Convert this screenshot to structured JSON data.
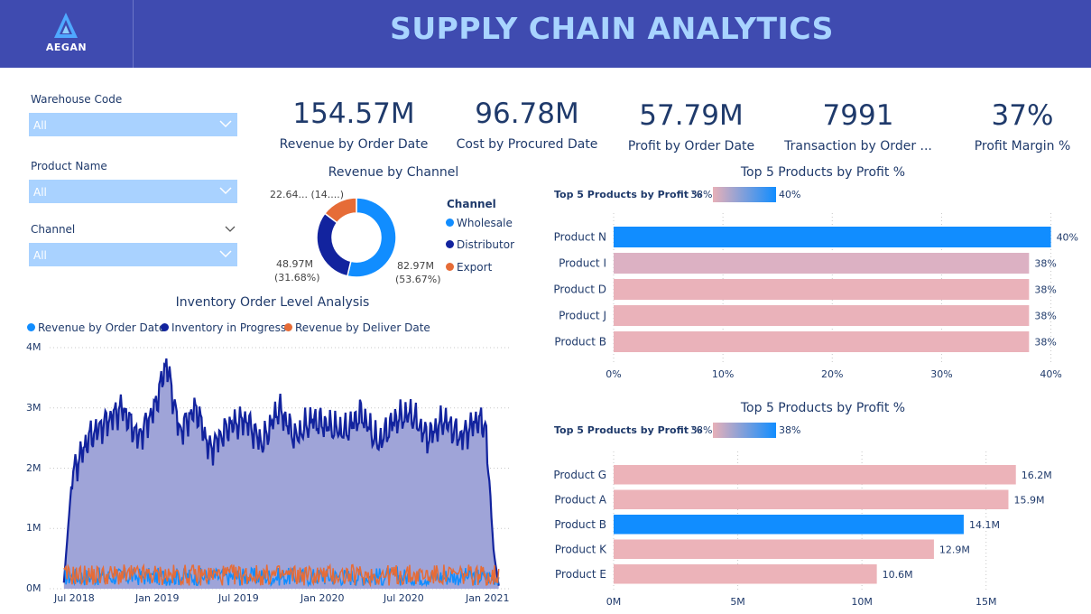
{
  "header": {
    "logo_text": "AEGAN",
    "title": "SUPPLY CHAIN ANALYTICS"
  },
  "filters": [
    {
      "label": "Warehouse Code",
      "value": "All"
    },
    {
      "label": "Product Name",
      "value": "All"
    },
    {
      "label": "Channel",
      "value": "All"
    }
  ],
  "kpis": [
    {
      "value": "154.57M",
      "label": "Revenue by Order Date"
    },
    {
      "value": "96.78M",
      "label": "Cost by Procured Date"
    },
    {
      "value": "57.79M",
      "label": "Profit by Order Date"
    },
    {
      "value": "7991",
      "label": "Transaction by Order ..."
    },
    {
      "value": "37%",
      "label": "Profit Margin %"
    }
  ],
  "colors": {
    "header": "#3f4bb0",
    "accent": "#118dff",
    "navy": "#12239e",
    "orange": "#e66c37",
    "pink": "#e8b0b8",
    "slicer": "#a9d2ff"
  },
  "chart_data": [
    {
      "type": "pie",
      "title": "Revenue by Channel",
      "legend_title": "Channel",
      "legend_position": "right",
      "categories": [
        "Wholesale",
        "Distributor",
        "Export"
      ],
      "values": [
        82.97,
        48.97,
        22.64
      ],
      "percents": [
        53.67,
        31.68,
        14.65
      ],
      "data_labels": [
        [
          "82.97M",
          "(53.67%)"
        ],
        [
          "48.97M",
          "(31.68%)"
        ],
        [
          "22.64... (14....)"
        ]
      ],
      "colors": [
        "#118dff",
        "#12239e",
        "#e66c37"
      ]
    },
    {
      "type": "area",
      "title": "Inventory Order Level Analysis",
      "legend_position": "top-left",
      "x_ticks": [
        "Jul 2018",
        "Jan 2019",
        "Jul 2019",
        "Jan 2020",
        "Jul 2020",
        "Jan 2021"
      ],
      "y_ticks": [
        "0M",
        "1M",
        "2M",
        "3M",
        "4M"
      ],
      "ylim": [
        0,
        4
      ],
      "grid": true,
      "series": [
        {
          "name": "Revenue by Order Date",
          "color": "#118dff",
          "approx_range_millions": [
            0.05,
            0.35
          ]
        },
        {
          "name": "Inventory in Progress",
          "color": "#12239e",
          "approx_range_millions": [
            1.7,
            3.9
          ],
          "knots": [
            [
              2018.45,
              0.1
            ],
            [
              2018.5,
              1.9
            ],
            [
              2018.6,
              2.5
            ],
            [
              2018.72,
              2.8
            ],
            [
              2018.8,
              3.0
            ],
            [
              2018.9,
              2.5
            ],
            [
              2019.0,
              3.0
            ],
            [
              2019.07,
              3.75
            ],
            [
              2019.15,
              2.6
            ],
            [
              2019.25,
              3.0
            ],
            [
              2019.33,
              2.3
            ],
            [
              2019.45,
              2.7
            ],
            [
              2019.55,
              2.8
            ],
            [
              2019.65,
              2.4
            ],
            [
              2019.75,
              3.0
            ],
            [
              2019.85,
              2.5
            ],
            [
              2019.95,
              2.8
            ],
            [
              2020.05,
              2.7
            ],
            [
              2020.15,
              2.6
            ],
            [
              2020.25,
              2.9
            ],
            [
              2020.35,
              2.4
            ],
            [
              2020.45,
              2.8
            ],
            [
              2020.55,
              2.9
            ],
            [
              2020.65,
              2.5
            ],
            [
              2020.75,
              2.8
            ],
            [
              2020.85,
              2.5
            ],
            [
              2020.95,
              2.8
            ],
            [
              2021.0,
              2.7
            ],
            [
              2021.05,
              0.6
            ],
            [
              2021.08,
              0.05
            ]
          ]
        },
        {
          "name": "Revenue by Deliver Date",
          "color": "#e66c37",
          "approx_range_millions": [
            0.05,
            0.4
          ]
        }
      ]
    },
    {
      "type": "bar",
      "title": "Top 5 Products by Profit %",
      "gradient_legend": {
        "label": "Top 5 Products by Profit %",
        "min": "38%",
        "max": "40%"
      },
      "categories": [
        "Product N",
        "Product I",
        "Product D",
        "Product J",
        "Product B"
      ],
      "values": [
        40,
        38,
        38,
        38,
        38
      ],
      "data_labels": [
        "40%",
        "38%",
        "38%",
        "38%",
        "38%"
      ],
      "x_ticks": [
        "0%",
        "10%",
        "20%",
        "30%",
        "40%"
      ],
      "xlim": [
        0,
        40.2
      ],
      "highlight": "Product N"
    },
    {
      "type": "bar",
      "title": "Top 5 Products by Profit %",
      "gradient_legend": {
        "label": "Top 5 Products by Profit %",
        "min": "38%",
        "max": "38%"
      },
      "categories": [
        "Product G",
        "Product A",
        "Product B",
        "Product K",
        "Product E"
      ],
      "values": [
        16.2,
        15.9,
        14.1,
        12.9,
        10.6
      ],
      "data_labels": [
        "16.2M",
        "15.9M",
        "14.1M",
        "12.9M",
        "10.6M"
      ],
      "x_ticks": [
        "0M",
        "5M",
        "10M",
        "15M"
      ],
      "xlim": [
        0,
        17.3
      ],
      "highlight": "Product B"
    }
  ]
}
